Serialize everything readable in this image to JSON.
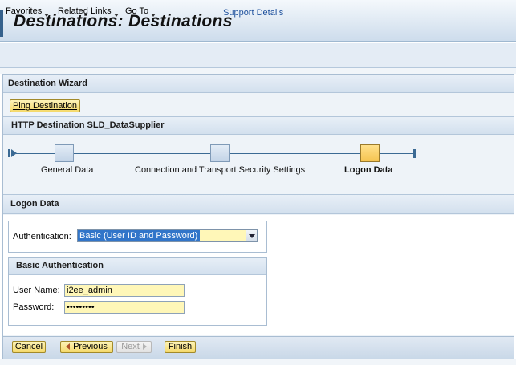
{
  "page": {
    "title": "Destinations: Destinations"
  },
  "menubar": {
    "items": [
      {
        "label": "Favorites"
      },
      {
        "label": "Related Links"
      },
      {
        "label": "Go To"
      }
    ],
    "support_link": "Support Details"
  },
  "wizard": {
    "title": "Destination Wizard",
    "ping_button": "Ping Destination",
    "destination_title": "HTTP Destination SLD_DataSupplier",
    "steps": [
      {
        "label": "General Data",
        "active": false
      },
      {
        "label": "Connection and Transport Security Settings",
        "active": false
      },
      {
        "label": "Logon Data",
        "active": true
      }
    ]
  },
  "logon": {
    "section_title": "Logon Data",
    "authentication_label": "Authentication:",
    "authentication_value": "Basic (User ID and Password)",
    "basic_auth_title": "Basic Authentication",
    "user_name_label": "User Name:",
    "user_name_value": "i2ee_admin",
    "password_label": "Password:",
    "password_value": "•••••••••"
  },
  "footer": {
    "cancel": "Cancel",
    "previous": "Previous",
    "next": "Next",
    "finish": "Finish"
  },
  "colors": {
    "accent": "#35618c",
    "button_yellow": "#f5d96a",
    "input_yellow": "#fff7b8",
    "selection_blue": "#3175c9"
  }
}
